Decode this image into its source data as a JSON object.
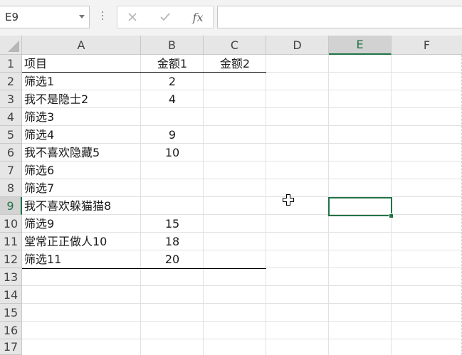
{
  "formula_bar": {
    "name_box": "E9",
    "cancel_icon": "close-icon",
    "enter_icon": "check-icon",
    "fx_label": "fx",
    "formula": ""
  },
  "columns": [
    "A",
    "B",
    "C",
    "D",
    "E",
    "F"
  ],
  "selected_column": "E",
  "rows": [
    "1",
    "2",
    "3",
    "4",
    "5",
    "6",
    "7",
    "8",
    "9",
    "10",
    "11",
    "12",
    "13",
    "14",
    "15",
    "16",
    "17"
  ],
  "selected_row": "9",
  "cells": {
    "headers": {
      "a": "项目",
      "b": "金额1",
      "c": "金额2"
    },
    "data": [
      {
        "a": "筛选1",
        "b": "2"
      },
      {
        "a": "我不是隐士2",
        "b": "4"
      },
      {
        "a": "筛选3",
        "b": ""
      },
      {
        "a": "筛选4",
        "b": "9"
      },
      {
        "a": "我不喜欢隐藏5",
        "b": "10"
      },
      {
        "a": "筛选6",
        "b": ""
      },
      {
        "a": "筛选7",
        "b": ""
      },
      {
        "a": "我不喜欢躲猫猫8",
        "b": ""
      },
      {
        "a": "筛选9",
        "b": "15"
      },
      {
        "a": "堂常正正做人10",
        "b": "18"
      },
      {
        "a": "筛选11",
        "b": "20"
      }
    ]
  },
  "colors": {
    "accent": "#217346"
  }
}
